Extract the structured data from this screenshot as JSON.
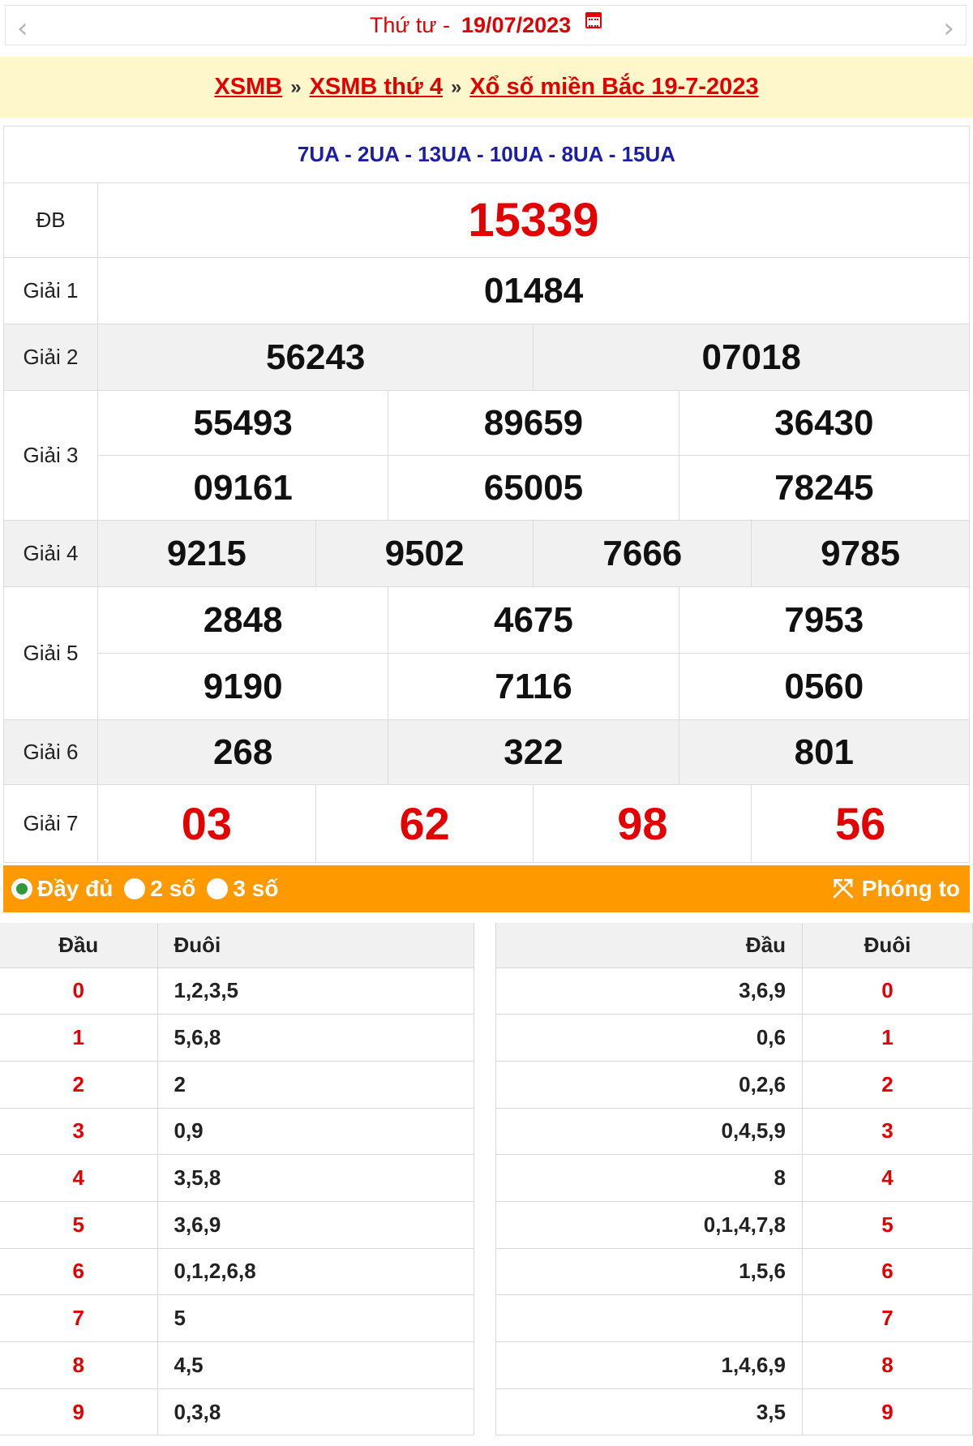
{
  "date_nav": {
    "prev_icon": "chevron-left-icon",
    "weekday": "Thứ tư -",
    "date": "19/07/2023",
    "calendar_icon": "calendar-icon",
    "next_icon": "chevron-right-icon"
  },
  "breadcrumb": {
    "items": [
      "XSMB",
      "XSMB thứ 4",
      "Xổ số miền Bắc 19-7-2023"
    ],
    "separator": "»"
  },
  "codes": "7UA - 2UA - 13UA - 10UA - 8UA - 15UA",
  "prizes": {
    "db": {
      "label": "ĐB",
      "numbers": [
        "15339"
      ]
    },
    "g1": {
      "label": "Giải 1",
      "numbers": [
        "01484"
      ]
    },
    "g2": {
      "label": "Giải 2",
      "numbers": [
        "56243",
        "07018"
      ]
    },
    "g3": {
      "label": "Giải 3",
      "numbers": [
        "55493",
        "89659",
        "36430",
        "09161",
        "65005",
        "78245"
      ]
    },
    "g4": {
      "label": "Giải 4",
      "numbers": [
        "9215",
        "9502",
        "7666",
        "9785"
      ]
    },
    "g5": {
      "label": "Giải 5",
      "numbers": [
        "2848",
        "4675",
        "7953",
        "9190",
        "7116",
        "0560"
      ]
    },
    "g6": {
      "label": "Giải 6",
      "numbers": [
        "268",
        "322",
        "801"
      ]
    },
    "g7": {
      "label": "Giải 7",
      "numbers": [
        "03",
        "62",
        "98",
        "56"
      ]
    }
  },
  "options": {
    "full": "Đầy đủ",
    "two": "2 số",
    "three": "3 số",
    "selected": "full",
    "zoom_label": "Phóng to",
    "zoom_icon": "expand-icon",
    "bar_color": "#ff9900"
  },
  "dau_table": {
    "headers": [
      "Đầu",
      "Đuôi"
    ],
    "rows": [
      {
        "dau": "0",
        "duoi": "1,2,3,5"
      },
      {
        "dau": "1",
        "duoi": "5,6,8"
      },
      {
        "dau": "2",
        "duoi": "2"
      },
      {
        "dau": "3",
        "duoi": "0,9"
      },
      {
        "dau": "4",
        "duoi": "3,5,8"
      },
      {
        "dau": "5",
        "duoi": "3,6,9"
      },
      {
        "dau": "6",
        "duoi": "0,1,2,6,8"
      },
      {
        "dau": "7",
        "duoi": "5"
      },
      {
        "dau": "8",
        "duoi": "4,5"
      },
      {
        "dau": "9",
        "duoi": "0,3,8"
      }
    ]
  },
  "duoi_table": {
    "headers": [
      "Đầu",
      "Đuôi"
    ],
    "rows": [
      {
        "dau": "3,6,9",
        "duoi": "0"
      },
      {
        "dau": "0,6",
        "duoi": "1"
      },
      {
        "dau": "0,2,6",
        "duoi": "2"
      },
      {
        "dau": "0,4,5,9",
        "duoi": "3"
      },
      {
        "dau": "8",
        "duoi": "4"
      },
      {
        "dau": "0,1,4,7,8",
        "duoi": "5"
      },
      {
        "dau": "1,5,6",
        "duoi": "6"
      },
      {
        "dau": "",
        "duoi": "7"
      },
      {
        "dau": "1,4,6,9",
        "duoi": "8"
      },
      {
        "dau": "3,5",
        "duoi": "9"
      }
    ]
  },
  "colors": {
    "accent_red": "#e40000",
    "code_blue": "#1c1fa6",
    "crumb_bg": "#fef7cc"
  }
}
